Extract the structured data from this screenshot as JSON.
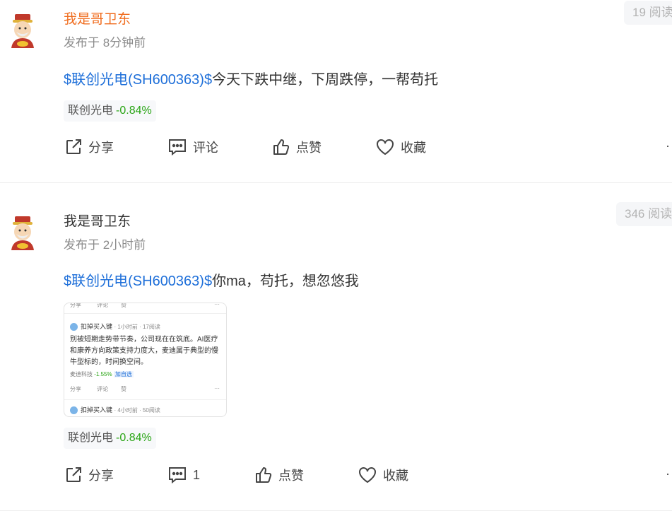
{
  "posts": [
    {
      "author": "我是哥卫东",
      "time": "发布于 8分钟前",
      "reads": "19 阅读",
      "stock_link": "$联创光电(SH600363)$",
      "text": "今天下跌中继，下周跌停，一帮苟托",
      "tag_name": "联创光电",
      "tag_change": "-0.84%",
      "actions": {
        "share": "分享",
        "comment": "评论",
        "like": "点赞",
        "favorite": "收藏"
      }
    },
    {
      "author": "我是哥卫东",
      "time": "发布于 2小时前",
      "reads": "346 阅读",
      "stock_link": "$联创光电(SH600363)$",
      "text": "你ma，苟托，想忽悠我",
      "tag_name": "联创光电",
      "tag_change": "-0.84%",
      "actions": {
        "share": "分享",
        "comment": "1",
        "like": "点赞",
        "favorite": "收藏"
      },
      "image": {
        "top_actions": {
          "share": "分享",
          "comment": "评论",
          "like": "赞"
        },
        "author": "扣掉买入键",
        "meta": "· 1小时前 · 17阅读",
        "text": "别被短期走势带节奏，公司现在在筑底。AI医疗和康养方向政策支持力度大，麦迪属于典型的慢牛型标的，时间换空间。",
        "tag_name": "麦迪科技",
        "tag_change": "-1.55%",
        "tag_extra": "加自选",
        "bottom_actions": {
          "share": "分享",
          "comment": "评论",
          "like": "赞"
        },
        "author2": "扣掉买入键",
        "meta2": "· 4小时前 · 50阅读"
      }
    }
  ],
  "colors": {
    "link": "#1e6fd9",
    "author_highlight": "#f06d1f",
    "up_down": "#2aa515"
  }
}
